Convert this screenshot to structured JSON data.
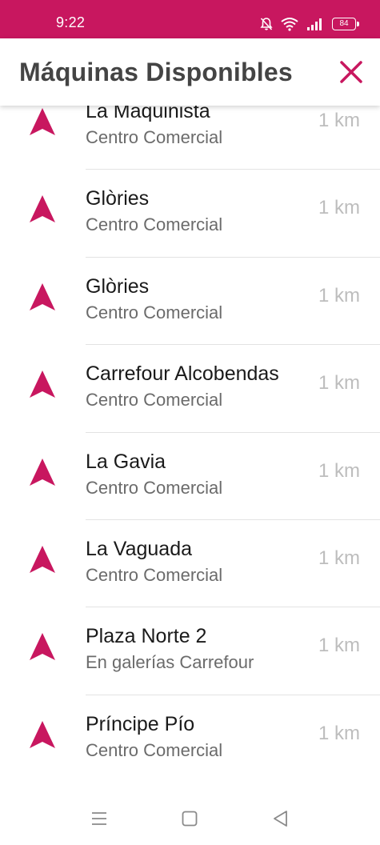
{
  "status_bar": {
    "time": "9:22",
    "battery": "84",
    "background_color": "#c8175f",
    "icons": [
      "bell-muted-icon",
      "wifi-icon",
      "signal-icon",
      "battery-icon"
    ]
  },
  "header": {
    "title": "Máquinas Disponibles",
    "close_icon": "close-icon",
    "accent_color": "#c8175f"
  },
  "locations": [
    {
      "name": "La Maquinista",
      "subtitle": "Centro Comercial",
      "distance": "1 km"
    },
    {
      "name": "Glòries",
      "subtitle": "Centro Comercial",
      "distance": "1 km"
    },
    {
      "name": "Glòries",
      "subtitle": "Centro Comercial",
      "distance": "1 km"
    },
    {
      "name": "Carrefour Alcobendas",
      "subtitle": "Centro Comercial",
      "distance": "1 km"
    },
    {
      "name": "La Gavia",
      "subtitle": "Centro Comercial",
      "distance": "1 km"
    },
    {
      "name": "La Vaguada",
      "subtitle": "Centro Comercial",
      "distance": "1 km"
    },
    {
      "name": "Plaza Norte 2",
      "subtitle": "En galerías Carrefour",
      "distance": "1 km"
    },
    {
      "name": "Príncipe Pío",
      "subtitle": "Centro Comercial",
      "distance": "1 km"
    }
  ],
  "nav_bar": {
    "buttons": [
      "menu-icon",
      "home-icon",
      "back-icon"
    ]
  }
}
